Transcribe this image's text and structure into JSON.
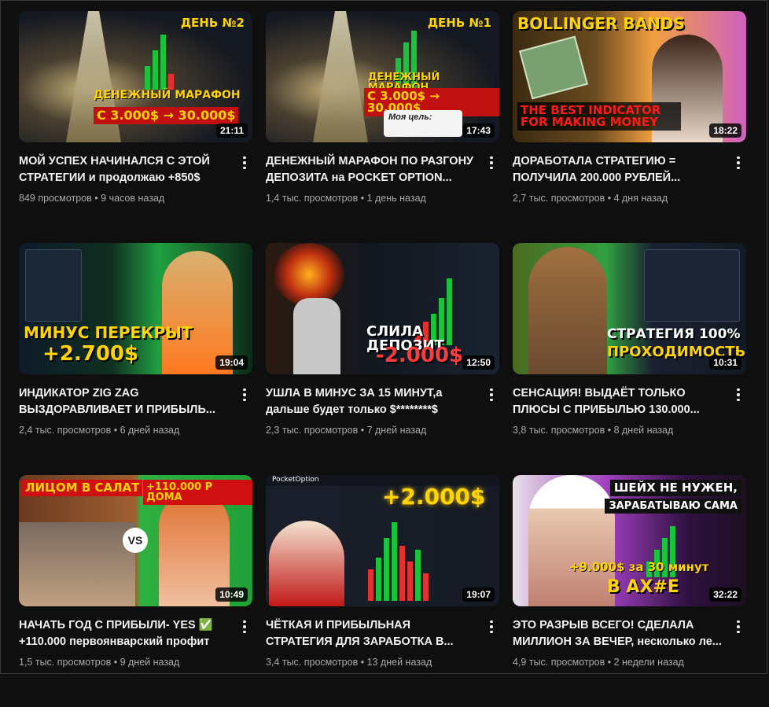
{
  "videos": [
    {
      "title": "МОЙ УСПЕХ НАЧИНАЛСЯ С ЭТОЙ СТРАТЕГИИ и продолжаю +850$",
      "views": "849 просмотров",
      "age": "9 часов назад",
      "duration": "21:11",
      "thumb_text_1": "ДЕНЬ №2",
      "thumb_text_2": "ДЕНЕЖНЫЙ МАРАФОН",
      "thumb_text_3": "С 3.000$ → 30.000$"
    },
    {
      "title": "ДЕНЕЖНЫЙ МАРАФОН ПО РАЗГОНУ ДЕПОЗИТА на POCKET OPTION...",
      "views": "1,4 тыс. просмотров",
      "age": "1 день назад",
      "duration": "17:43",
      "thumb_text_1": "ДЕНЬ №1",
      "thumb_text_2": "ДЕНЕЖНЫЙ МАРАФОН",
      "thumb_text_3": "С 3.000$ → 30.000$",
      "thumb_text_4": "Моя цель:"
    },
    {
      "title": "ДОРАБОТАЛА СТРАТЕГИЮ = ПОЛУЧИЛА 200.000 РУБЛЕЙ...",
      "views": "2,7 тыс. просмотров",
      "age": "4 дня назад",
      "duration": "18:22",
      "thumb_text_1": "BOLLINGER BANDS",
      "thumb_text_2": "THE BEST INDICATOR FOR MAKING MONEY"
    },
    {
      "title": "ИНДИКАТОР ZIG ZAG ВЫЗДОРАВЛИВАЕТ И ПРИБЫЛЬ...",
      "views": "2,4 тыс. просмотров",
      "age": "6 дней назад",
      "duration": "19:04",
      "thumb_text_1": "МИНУС ПЕРЕКРЫТ",
      "thumb_text_2": "+2.700$"
    },
    {
      "title": "УШЛА В МИНУС ЗА 15 МИНУТ,а дальше будет только $********$",
      "views": "2,3 тыс. просмотров",
      "age": "7 дней назад",
      "duration": "12:50",
      "thumb_text_1": "СЛИЛА ДЕПОЗИТ",
      "thumb_text_2": "-2.000$"
    },
    {
      "title": "СЕНСАЦИЯ! ВЫДАЁТ ТОЛЬКО ПЛЮСЫ С ПРИБЫЛЬЮ 130.000...",
      "views": "3,8 тыс. просмотров",
      "age": "8 дней назад",
      "duration": "10:31",
      "thumb_text_1": "СТРАТЕГИЯ 100%",
      "thumb_text_2": "ПРОХОДИМОСТЬ"
    },
    {
      "title": "НАЧАТЬ ГОД С ПРИБЫЛИ- YES ✅ +110.000 первоянварский профит",
      "views": "1,5 тыс. просмотров",
      "age": "9 дней назад",
      "duration": "10:49",
      "thumb_text_1": "ЛИЦОМ В САЛАТ",
      "thumb_text_2": "+110.000 Р ДОМА",
      "thumb_text_3": "VS"
    },
    {
      "title": "ЧЁТКАЯ И ПРИБЫЛЬНАЯ СТРАТЕГИЯ ДЛЯ ЗАРАБОТКА В...",
      "views": "3,4 тыс. просмотров",
      "age": "13 дней назад",
      "duration": "19:07",
      "thumb_text_1": "+2.000$",
      "thumb_text_2": "PocketOption"
    },
    {
      "title": "ЭТО РАЗРЫВ ВСЕГО! СДЕЛАЛА МИЛЛИОН ЗА ВЕЧЕР, несколько ле...",
      "views": "4,9 тыс. просмотров",
      "age": "2 недели назад",
      "duration": "32:22",
      "thumb_text_1": "ШЕЙХ НЕ НУЖЕН,",
      "thumb_text_2": "ЗАРАБАТЫВАЮ САМА",
      "thumb_text_3": "+9.000$ за 30 минут",
      "thumb_text_4": "В АХ#Е"
    }
  ],
  "separator": "•",
  "icons": {
    "menu": "more-vert-icon"
  }
}
